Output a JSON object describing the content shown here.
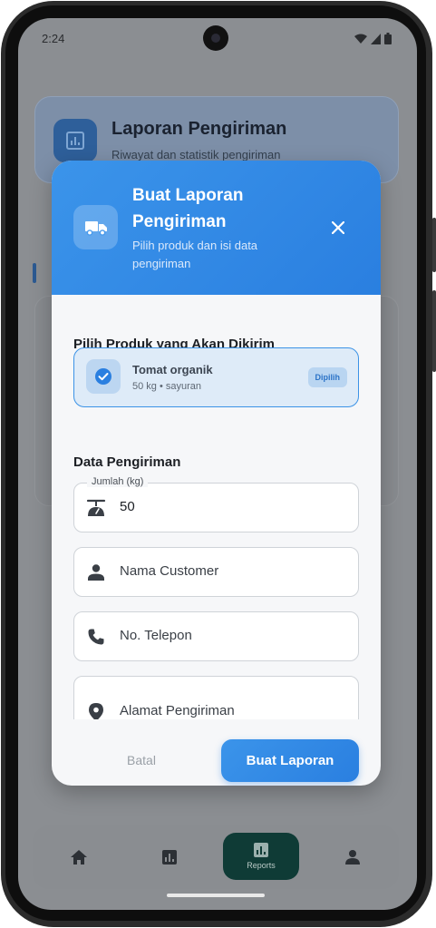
{
  "status_bar": {
    "time": "2:24"
  },
  "background_page": {
    "title": "Laporan Pengiriman",
    "subtitle": "Riwayat dan statistik pengiriman"
  },
  "bottom_nav": {
    "items": [
      {
        "icon": "home-icon"
      },
      {
        "icon": "chart-icon"
      },
      {
        "icon": "chart-icon",
        "label": "Reports",
        "active": true
      },
      {
        "icon": "person-icon"
      }
    ]
  },
  "dialog": {
    "title": "Buat Laporan Pengiriman",
    "subtitle": "Pilih produk dan isi data pengiriman",
    "product_section_title": "Pilih Produk yang Akan Dikirim",
    "selected_product": {
      "name": "Tomat organik",
      "meta": "50 kg • sayuran",
      "badge": "Dipilih"
    },
    "shipping_section_title": "Data Pengiriman",
    "fields": {
      "quantity": {
        "label": "Jumlah (kg)",
        "value": "50"
      },
      "customer": {
        "placeholder": "Nama Customer"
      },
      "phone": {
        "placeholder": "No. Telepon"
      },
      "address": {
        "placeholder": "Alamat Pengiriman"
      }
    },
    "cancel_label": "Batal",
    "submit_label": "Buat Laporan"
  },
  "colors": {
    "accent": "#2a7fe0",
    "header_gradient_start": "#3b94ea",
    "badge_text": "#2b73c7",
    "nav_active_bg": "#0f3b36"
  }
}
